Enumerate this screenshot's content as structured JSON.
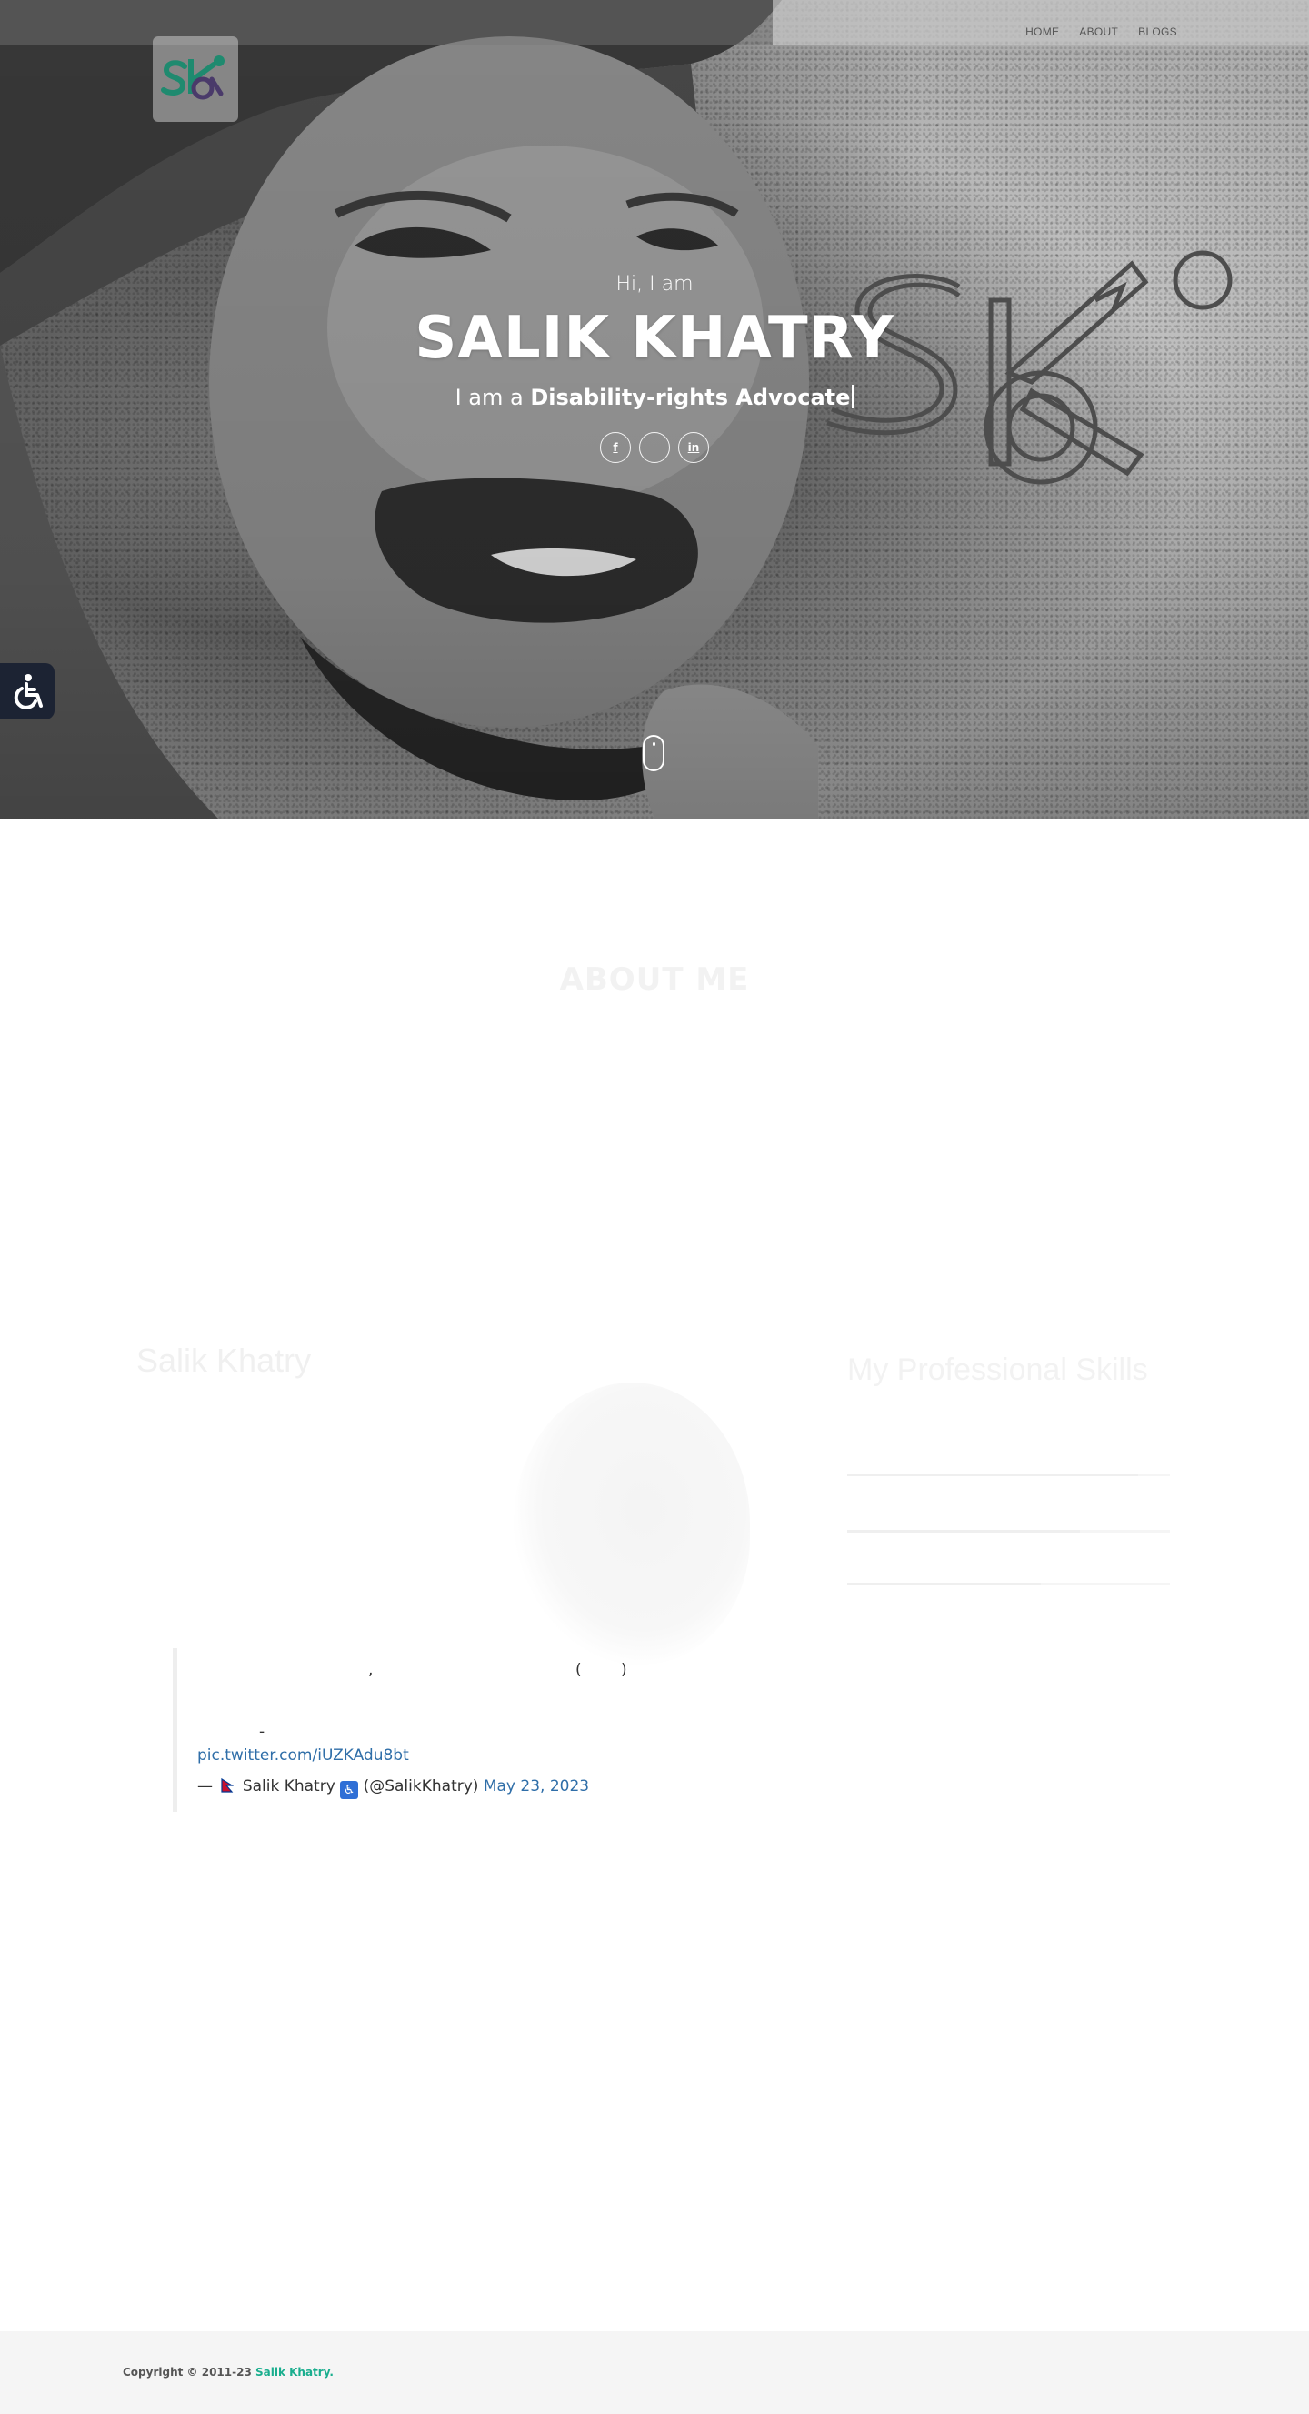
{
  "nav": {
    "items": [
      {
        "label": "HOME"
      },
      {
        "label": "ABOUT"
      },
      {
        "label": "BLOGS"
      }
    ]
  },
  "logo": {
    "text": "Sk"
  },
  "hero": {
    "greeting": "Hi, I am",
    "name": "SALIK KHATRY",
    "role_prefix": "I am a",
    "role": "Disability-rights Advocate",
    "socials": [
      {
        "icon": "facebook-icon",
        "glyph": "f"
      },
      {
        "icon": "twitter-icon",
        "glyph": ""
      },
      {
        "icon": "linkedin-icon",
        "glyph": "in"
      }
    ],
    "watermark": "Sk"
  },
  "about": {
    "title": "ABOUT ME",
    "name": "Salik Khatry",
    "skills_title": "My Professional Skills",
    "skills": [
      {
        "fill": 0.9
      },
      {
        "fill": 0.72
      },
      {
        "fill": 0.6
      }
    ]
  },
  "tweet": {
    "comma": ",",
    "paren_open": "(",
    "paren_close": ")",
    "dash": "-",
    "link": "pic.twitter.com/iUZKAdu8bt",
    "attribution_prefix": "—",
    "author": "Salik Khatry",
    "handle": "(@SalikKhatry)",
    "date": "May 23, 2023"
  },
  "footer": {
    "copyright": "Copyright © 2011-23",
    "owner": "Salik Khatry."
  },
  "colors": {
    "accent": "#1aae8e",
    "link": "#2f6ea8",
    "a11y_button": "#1c2333"
  }
}
